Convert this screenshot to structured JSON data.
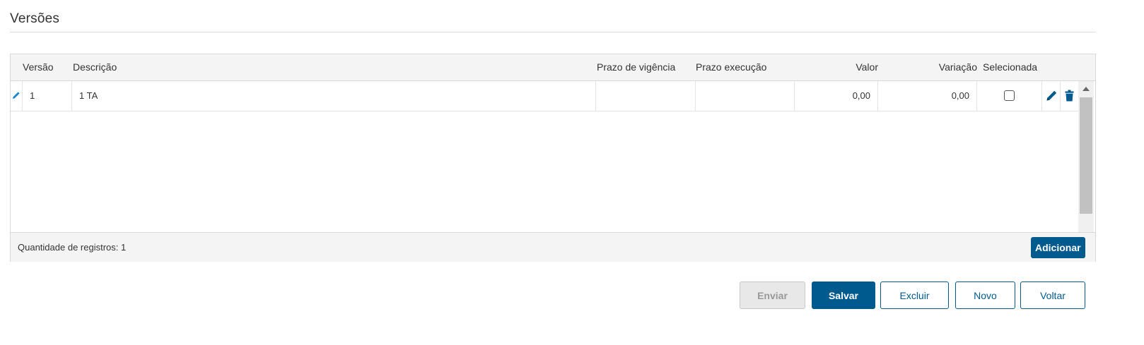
{
  "section": {
    "title": "Versões"
  },
  "grid": {
    "columns": {
      "version": "Versão",
      "description": "Descrição",
      "validity_term": "Prazo de vigência",
      "execution_term": "Prazo execução",
      "value": "Valor",
      "variation": "Variação",
      "selected": "Selecionada"
    },
    "rows": [
      {
        "version": "1",
        "description": "1 TA",
        "validity_term": "",
        "execution_term": "",
        "value": "0,00",
        "variation": "0,00",
        "selected": false
      }
    ],
    "footer": {
      "record_count": "Quantidade de registros: 1",
      "add_label": "Adicionar"
    }
  },
  "actions": {
    "send_label": "Enviar",
    "save_label": "Salvar",
    "delete_label": "Excluir",
    "new_label": "Novo",
    "back_label": "Voltar"
  },
  "colors": {
    "primary": "#005a8e",
    "edit_icon": "#1a86c8",
    "header_bg": "#f4f4f4"
  },
  "icons": [
    "pencil-icon",
    "edit-icon",
    "trash-icon",
    "scroll-up-icon",
    "scroll-down-icon"
  ]
}
